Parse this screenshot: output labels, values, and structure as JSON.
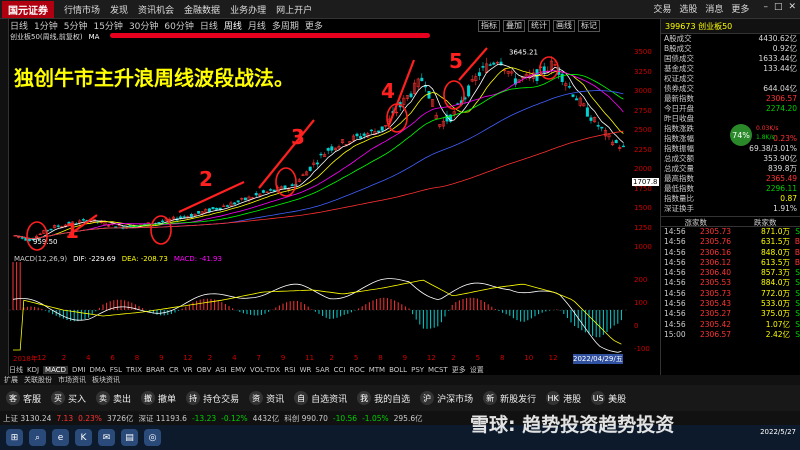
{
  "app": {
    "logo_text": "国元证券",
    "logo_sub": "GUOYUAN SECURITIES"
  },
  "menu": [
    "行情市场",
    "发现",
    "资讯机会",
    "金融数据",
    "业务办理",
    "网上开户"
  ],
  "menu_right": [
    "交易",
    "选股",
    "消息",
    "更多"
  ],
  "toolbar": [
    "日线",
    "1分钟",
    "5分钟",
    "15分钟",
    "30分钟",
    "60分钟",
    "日线",
    "周线",
    "月线",
    "多周期",
    "更多"
  ],
  "toolbar2": [
    "指标",
    "叠加",
    "统计",
    "画线",
    "标记"
  ],
  "chart_title": "创业板50(周线,前复权)",
  "ma_label": "MA",
  "headline": "独创牛市主升浪周线波段战法。",
  "waves": [
    "1",
    "2",
    "3",
    "4",
    "5"
  ],
  "price_labels": {
    "high": "3645.21",
    "low": "959.50"
  },
  "y_axis": [
    "3500",
    "3250",
    "3000",
    "2750",
    "2500",
    "2250",
    "2000",
    "1750",
    "1500",
    "1250",
    "1000"
  ],
  "macd_y": [
    "200",
    "100",
    "0",
    "-100"
  ],
  "current_price_tag": "1707.8",
  "macd_label": [
    "MACD(12,26,9)",
    "DIF: -229.69",
    "DEA: -208.73",
    "MACD: -41.93"
  ],
  "x_axis": [
    "2018年",
    "12",
    "2",
    "4",
    "6",
    "8",
    "9",
    "12",
    "2",
    "4",
    "7",
    "9",
    "11",
    "2",
    "5",
    "8",
    "9",
    "12",
    "2",
    "5",
    "8",
    "10",
    "12",
    "2022/04/29/五"
  ],
  "indicator_tabs": [
    "日线",
    "KDJ",
    "MACD",
    "DMI",
    "DMA",
    "FSL",
    "TRIX",
    "BRAR",
    "CR",
    "VR",
    "OBV",
    "ASI",
    "EMV",
    "VOL-TDX",
    "RSI",
    "WR",
    "SAR",
    "CCI",
    "ROC",
    "MTM",
    "BOLL",
    "PSY",
    "MCST",
    "更多",
    "设置"
  ],
  "bottom_tabs": [
    "扩展",
    "关联股份",
    "市场资讯",
    "板块资讯"
  ],
  "side": {
    "code": "399673",
    "name": "创业板50",
    "rows": [
      {
        "k": "A股成交",
        "v": "4430.62亿",
        "c": ""
      },
      {
        "k": "B股成交",
        "v": "0.92亿",
        "c": ""
      },
      {
        "k": "国债成交",
        "v": "1633.44亿",
        "c": ""
      },
      {
        "k": "基金成交",
        "v": "133.44亿",
        "c": ""
      },
      {
        "k": "权证成交",
        "v": "",
        "c": ""
      },
      {
        "k": "债券成交",
        "v": "644.04亿",
        "c": ""
      },
      {
        "k": "最新指数",
        "v": "2306.57",
        "c": "red"
      },
      {
        "k": "今日开盘",
        "v": "2274.20",
        "c": "green"
      },
      {
        "k": "昨日收盘",
        "v": "",
        "c": ""
      },
      {
        "k": "指数涨跌",
        "v": "",
        "c": ""
      },
      {
        "k": "指数涨幅",
        "v": "0.23%",
        "c": "red"
      },
      {
        "k": "指数振幅",
        "v": "69.38/3.01%",
        "c": ""
      },
      {
        "k": "总成交额",
        "v": "353.90亿",
        "c": ""
      },
      {
        "k": "总成交量",
        "v": "839.8万",
        "c": ""
      },
      {
        "k": "最高指数",
        "v": "2365.49",
        "c": "red"
      },
      {
        "k": "最低指数",
        "v": "2296.11",
        "c": "green"
      },
      {
        "k": "指数量比",
        "v": "0.87",
        "c": "yellow"
      },
      {
        "k": "深证换手",
        "v": "1.91%",
        "c": ""
      }
    ],
    "badge": "74%",
    "badge_up": "0.03K/s",
    "badge_down": "1.8K/s",
    "tick_head": [
      "涨家数",
      "跌家数"
    ],
    "ticks": [
      {
        "t": "14:56",
        "p": "2305.73",
        "v": "871.0万",
        "s": "S",
        "c": "red"
      },
      {
        "t": "14:56",
        "p": "2305.76",
        "v": "631.5万",
        "s": "B",
        "c": "red"
      },
      {
        "t": "14:56",
        "p": "2306.16",
        "v": "848.0万",
        "s": "B",
        "c": "red"
      },
      {
        "t": "14:56",
        "p": "2306.12",
        "v": "613.5万",
        "s": "B",
        "c": "red"
      },
      {
        "t": "14:56",
        "p": "2306.40",
        "v": "857.3万",
        "s": "S",
        "c": "red"
      },
      {
        "t": "14:56",
        "p": "2305.53",
        "v": "884.0万",
        "s": "S",
        "c": "red"
      },
      {
        "t": "14:56",
        "p": "2305.73",
        "v": "772.0万",
        "s": "S",
        "c": "red"
      },
      {
        "t": "14:56",
        "p": "2305.43",
        "v": "533.0万",
        "s": "S",
        "c": "red"
      },
      {
        "t": "14:56",
        "p": "2305.27",
        "v": "375.0万",
        "s": "S",
        "c": "red"
      },
      {
        "t": "14:56",
        "p": "2305.42",
        "v": "1.07亿",
        "s": "S",
        "c": "red"
      },
      {
        "t": "15:00",
        "p": "2306.57",
        "v": "2.42亿",
        "s": "S",
        "c": "red"
      }
    ]
  },
  "actions": [
    {
      "icon": "客",
      "label": "客服"
    },
    {
      "icon": "买",
      "label": "买入"
    },
    {
      "icon": "卖",
      "label": "卖出"
    },
    {
      "icon": "撤",
      "label": "撤单"
    },
    {
      "icon": "持",
      "label": "持仓交易"
    },
    {
      "icon": "资",
      "label": "资讯"
    },
    {
      "icon": "自",
      "label": "自选资讯"
    },
    {
      "icon": "我",
      "label": "我的自选"
    },
    {
      "icon": "沪",
      "label": "沪深市场"
    },
    {
      "icon": "新",
      "label": "新股发行"
    },
    {
      "icon": "HK",
      "label": "港股"
    },
    {
      "icon": "US",
      "label": "美股"
    }
  ],
  "status": [
    "上证 3130.24",
    "7.13",
    "0.23%",
    "3726亿",
    "深证 11193.6",
    "-13.23",
    "-0.12%",
    "4432亿",
    "科创 990.70",
    "-10.56",
    "-1.05%",
    "295.6亿"
  ],
  "watermark": "雪球: 趋势投资趋势投资",
  "clock": {
    "time": "",
    "date": "2022/5/27"
  },
  "colors": {
    "up": "#ff3232",
    "down": "#00d0d0",
    "accent": "#b00010"
  }
}
